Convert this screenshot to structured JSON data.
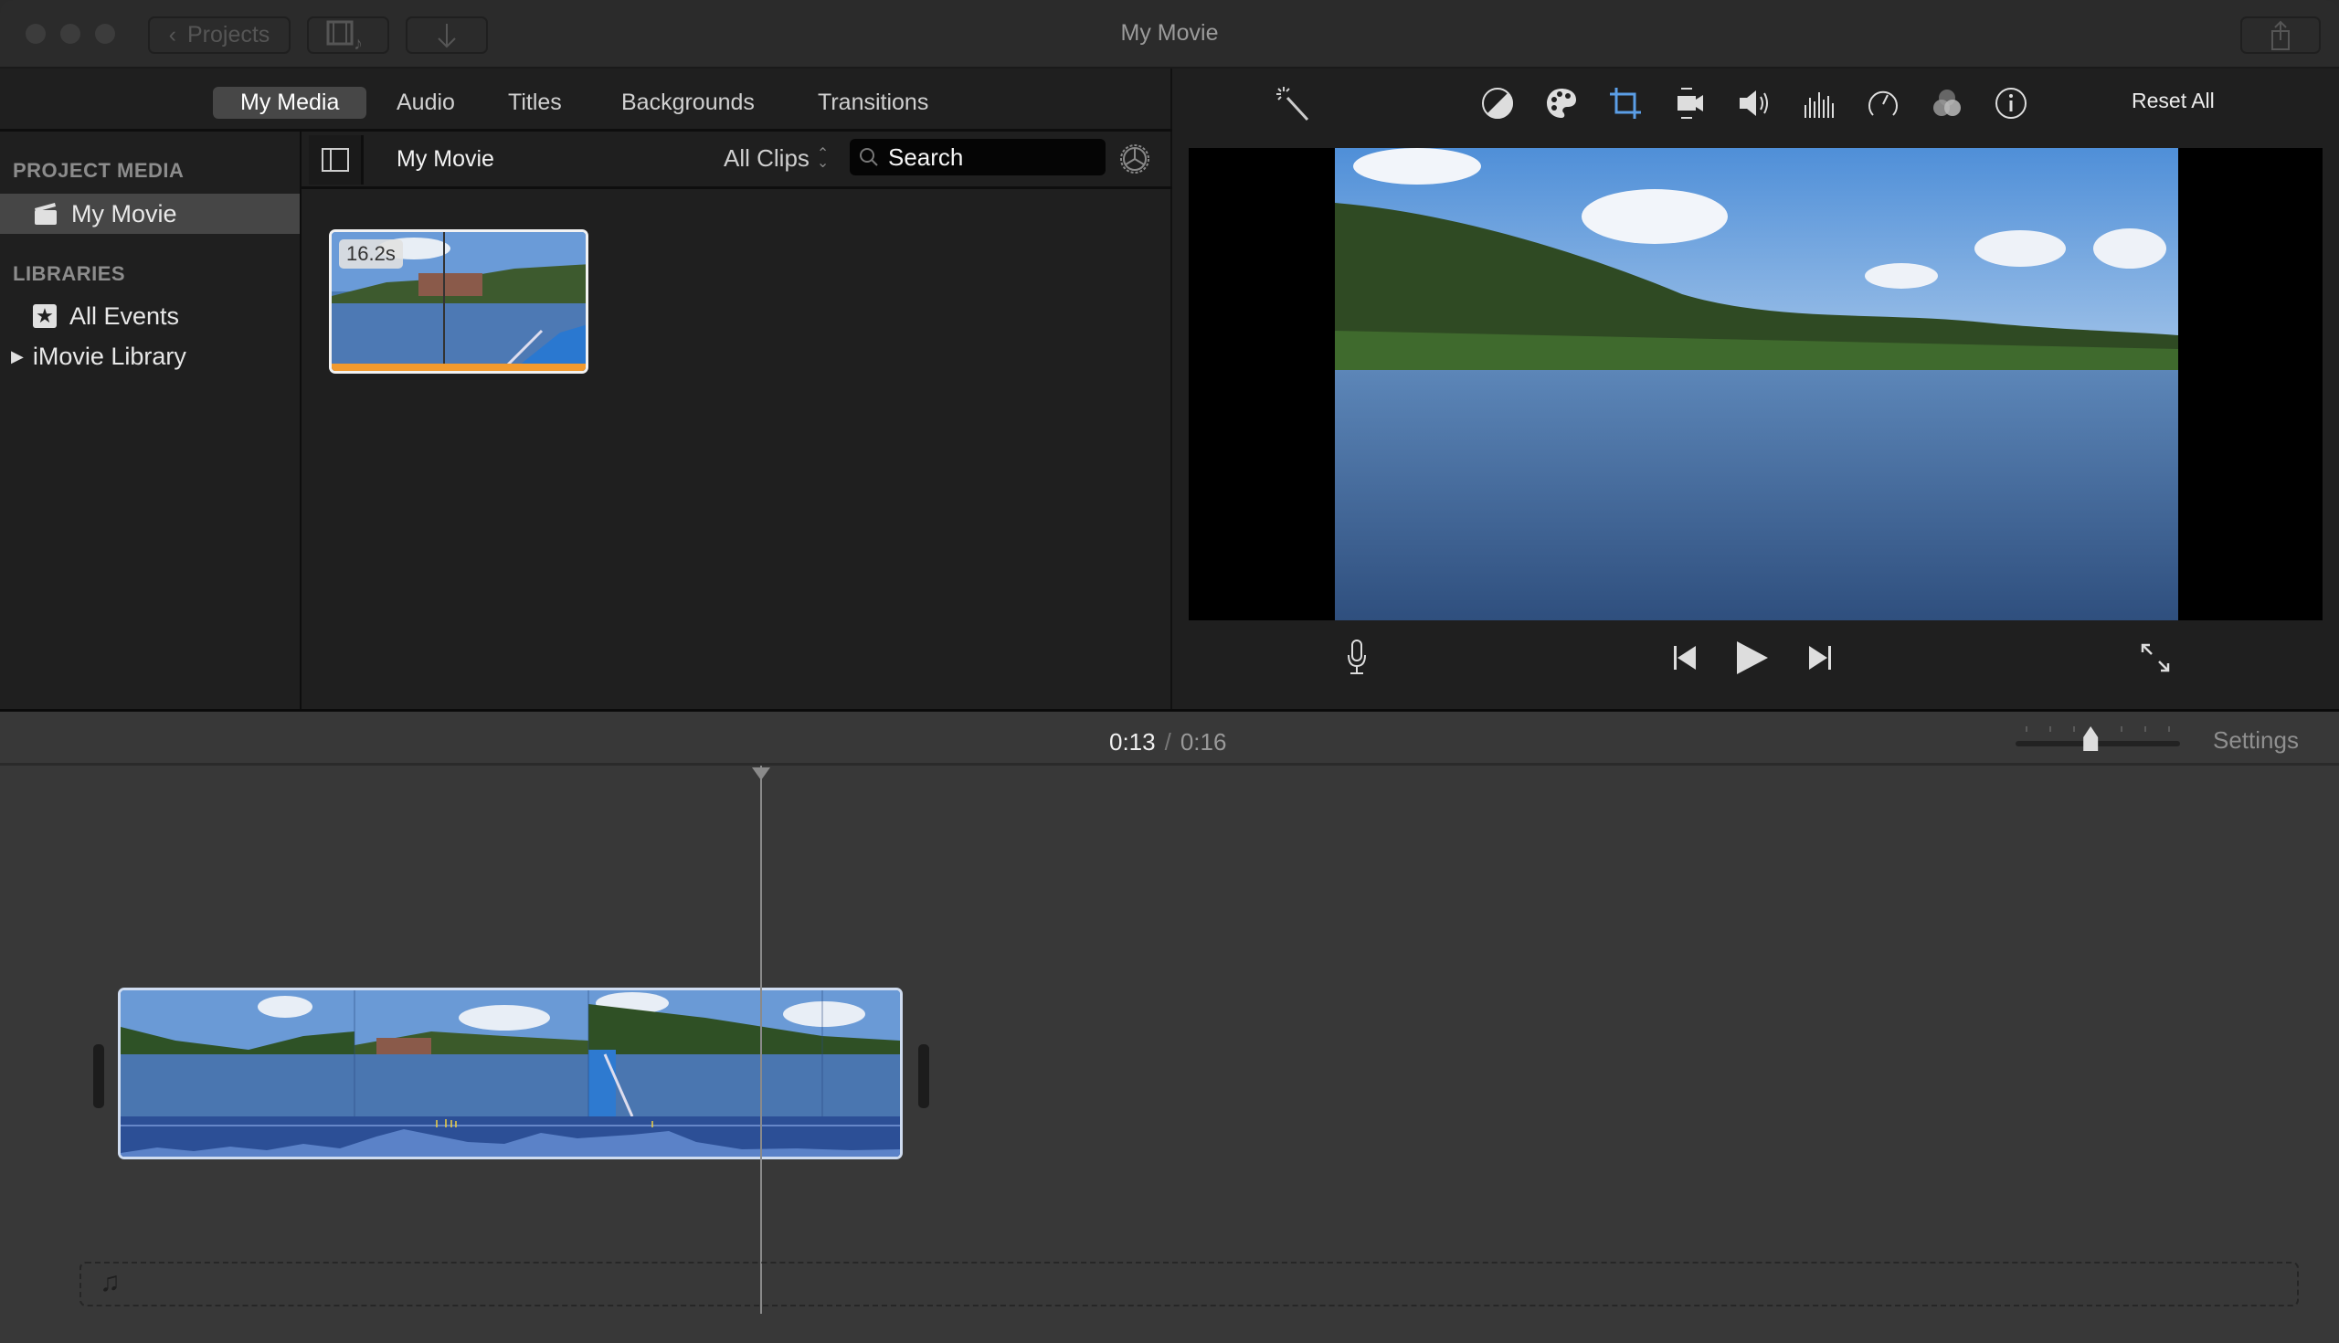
{
  "window": {
    "title": "My Movie",
    "projects_label": "Projects",
    "icons": {
      "media_toggle": "film-music-icon",
      "import": "download-arrow-icon",
      "share": "share-icon"
    }
  },
  "browser": {
    "tabs": [
      {
        "label": "My Media",
        "active": true
      },
      {
        "label": "Audio",
        "active": false
      },
      {
        "label": "Titles",
        "active": false
      },
      {
        "label": "Backgrounds",
        "active": false
      },
      {
        "label": "Transitions",
        "active": false
      }
    ],
    "header_title": "My Movie",
    "filter": "All Clips",
    "search_placeholder": "Search"
  },
  "sidebar": {
    "project_media_header": "PROJECT MEDIA",
    "project_item": "My Movie",
    "libraries_header": "LIBRARIES",
    "all_events": "All Events",
    "library": "iMovie Library"
  },
  "media": {
    "clips": [
      {
        "duration": "16.2s"
      }
    ]
  },
  "viewer": {
    "tools": [
      "magic-wand",
      "color-balance",
      "color-correction",
      "crop",
      "stabilization",
      "volume",
      "noise-reduction-equalizer",
      "speed",
      "clip-filter",
      "clip-info"
    ],
    "active_tool": "crop",
    "reset_all": "Reset All",
    "accent": "#5b9ee6"
  },
  "timeline": {
    "current_time": "0:13",
    "separator": "/",
    "total_time": "0:16",
    "settings_label": "Settings",
    "zoom_level_fraction": 0.45,
    "playhead_fraction": 0.8
  }
}
